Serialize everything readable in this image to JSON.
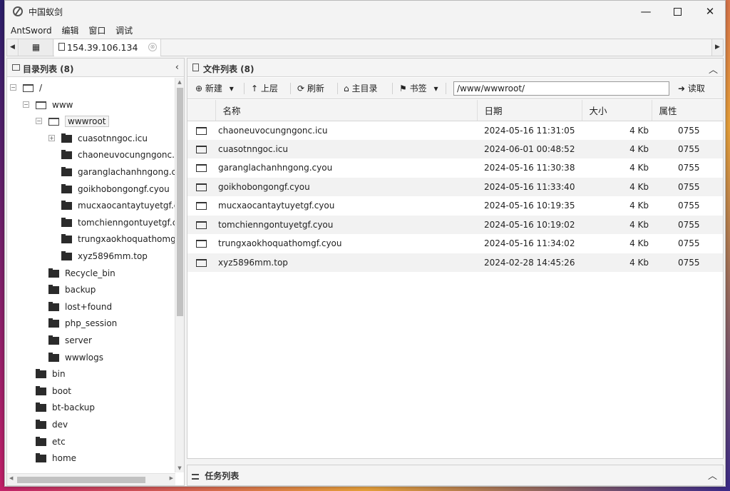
{
  "window": {
    "title": "中国蚁剑",
    "min_glyph": "—",
    "close_glyph": "✕"
  },
  "menu": [
    "AntSword",
    "编辑",
    "窗口",
    "调试"
  ],
  "tabs": {
    "grid_icon": "grid-icon",
    "active_label": "154.39.106.134",
    "close_glyph": "⊗",
    "scroll_left": "◀",
    "scroll_right": "▶"
  },
  "left_panel": {
    "title": "目录列表 (8)",
    "collapse_glyph": "‹",
    "tree": [
      {
        "label": "/",
        "depth": 0,
        "state": "open",
        "toggle": "⊟"
      },
      {
        "label": "www",
        "depth": 1,
        "state": "open",
        "toggle": "⊟"
      },
      {
        "label": "wwwroot",
        "depth": 2,
        "state": "open",
        "toggle": "⊟",
        "selected": true
      },
      {
        "label": "cuasotnngoc.icu",
        "depth": 3,
        "state": "closed",
        "toggle": "⊞"
      },
      {
        "label": "chaoneuvocungngonc.icu",
        "depth": 3,
        "state": "closed"
      },
      {
        "label": "garanglachanhngong.cyou",
        "depth": 3,
        "state": "closed"
      },
      {
        "label": "goikhobongongf.cyou",
        "depth": 3,
        "state": "closed"
      },
      {
        "label": "mucxaocantaytuyetgf.cyou",
        "depth": 3,
        "state": "closed"
      },
      {
        "label": "tomchienngontuyetgf.cyou",
        "depth": 3,
        "state": "closed"
      },
      {
        "label": "trungxaokhoquathomgf.cyou",
        "depth": 3,
        "state": "closed"
      },
      {
        "label": "xyz5896mm.top",
        "depth": 3,
        "state": "closed"
      },
      {
        "label": "Recycle_bin",
        "depth": 2,
        "state": "closed"
      },
      {
        "label": "backup",
        "depth": 2,
        "state": "closed"
      },
      {
        "label": "lost+found",
        "depth": 2,
        "state": "closed"
      },
      {
        "label": "php_session",
        "depth": 2,
        "state": "closed"
      },
      {
        "label": "server",
        "depth": 2,
        "state": "closed"
      },
      {
        "label": "wwwlogs",
        "depth": 2,
        "state": "closed"
      },
      {
        "label": "bin",
        "depth": 1,
        "state": "closed"
      },
      {
        "label": "boot",
        "depth": 1,
        "state": "closed"
      },
      {
        "label": "bt-backup",
        "depth": 1,
        "state": "closed"
      },
      {
        "label": "dev",
        "depth": 1,
        "state": "closed"
      },
      {
        "label": "etc",
        "depth": 1,
        "state": "closed"
      },
      {
        "label": "home",
        "depth": 1,
        "state": "closed"
      }
    ]
  },
  "right_panel": {
    "title": "文件列表 (8)",
    "collapse_glyph": "︿",
    "toolbar": {
      "new_label": "新建",
      "up_label": "上层",
      "refresh_label": "刷新",
      "home_label": "主目录",
      "bookmark_label": "书签",
      "path_value": "/www/wwwroot/",
      "read_label": "读取",
      "dropdown_glyph": "▾"
    },
    "columns": {
      "name": "名称",
      "date": "日期",
      "size": "大小",
      "perm": "属性"
    },
    "files": [
      {
        "name": "chaoneuvocungngonc.icu",
        "date": "2024-05-16 11:31:05",
        "size": "4 Kb",
        "perm": "0755"
      },
      {
        "name": "cuasotnngoc.icu",
        "date": "2024-06-01 00:48:52",
        "size": "4 Kb",
        "perm": "0755"
      },
      {
        "name": "garanglachanhngong.cyou",
        "date": "2024-05-16 11:30:38",
        "size": "4 Kb",
        "perm": "0755"
      },
      {
        "name": "goikhobongongf.cyou",
        "date": "2024-05-16 11:33:40",
        "size": "4 Kb",
        "perm": "0755"
      },
      {
        "name": "mucxaocantaytuyetgf.cyou",
        "date": "2024-05-16 10:19:35",
        "size": "4 Kb",
        "perm": "0755"
      },
      {
        "name": "tomchienngontuyetgf.cyou",
        "date": "2024-05-16 10:19:02",
        "size": "4 Kb",
        "perm": "0755"
      },
      {
        "name": "trungxaokhoquathomgf.cyou",
        "date": "2024-05-16 11:34:02",
        "size": "4 Kb",
        "perm": "0755"
      },
      {
        "name": "xyz5896mm.top",
        "date": "2024-02-28 14:45:26",
        "size": "4 Kb",
        "perm": "0755"
      }
    ]
  },
  "task_panel": {
    "title": "任务列表",
    "collapse_glyph": "︿"
  }
}
